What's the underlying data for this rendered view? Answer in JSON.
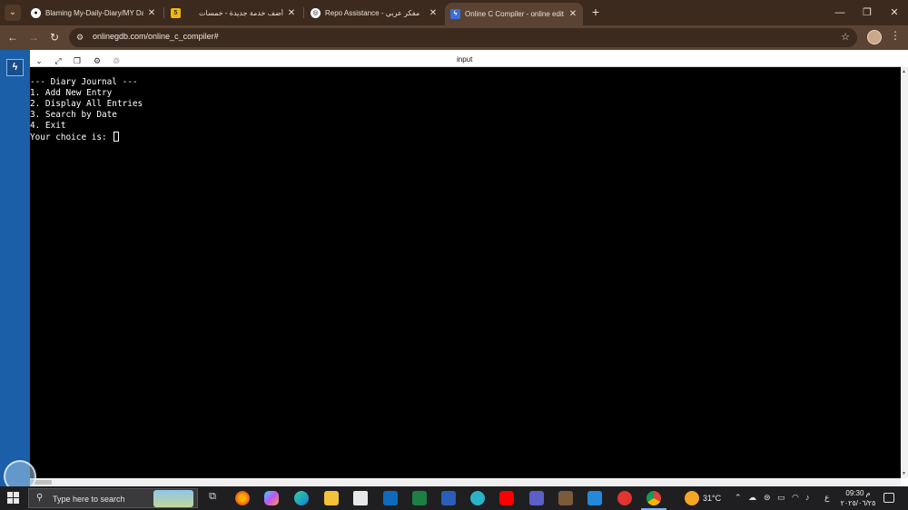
{
  "browser": {
    "tabs": [
      {
        "title": "Blaming My-Daily-Diary/MY Da",
        "favicon": "github-icon",
        "active": false
      },
      {
        "title": "أضف خدمة جديدة - خمسات",
        "favicon": "khamsat-icon",
        "active": false
      },
      {
        "title": "Repo Assistance - مفكر عربي",
        "favicon": "ai-icon",
        "active": false
      },
      {
        "title": "Online C Compiler - online edit",
        "favicon": "onlinegdb-icon",
        "active": true
      }
    ],
    "url": "onlinegdb.com/online_c_compiler#"
  },
  "io_panel": {
    "title": "input"
  },
  "console": {
    "lines": [
      "--- Diary Journal ---",
      "1. Add New Entry",
      "2. Display All Entries",
      "3. Search by Date",
      "4. Exit"
    ],
    "prompt": "Your choice is: "
  },
  "taskbar": {
    "search_placeholder": "Type here to search",
    "weather_temp": "31°C",
    "lang_indicator": "ع",
    "time": "09:30 م",
    "date": "٢٠٢٥/٠٦/٢٥"
  },
  "colors": {
    "tab_strip": "#3c2a1e",
    "toolbar": "#5b4333",
    "sidebar": "#1a5fa8",
    "console_bg": "#000000",
    "taskbar": "#1f1f22"
  }
}
